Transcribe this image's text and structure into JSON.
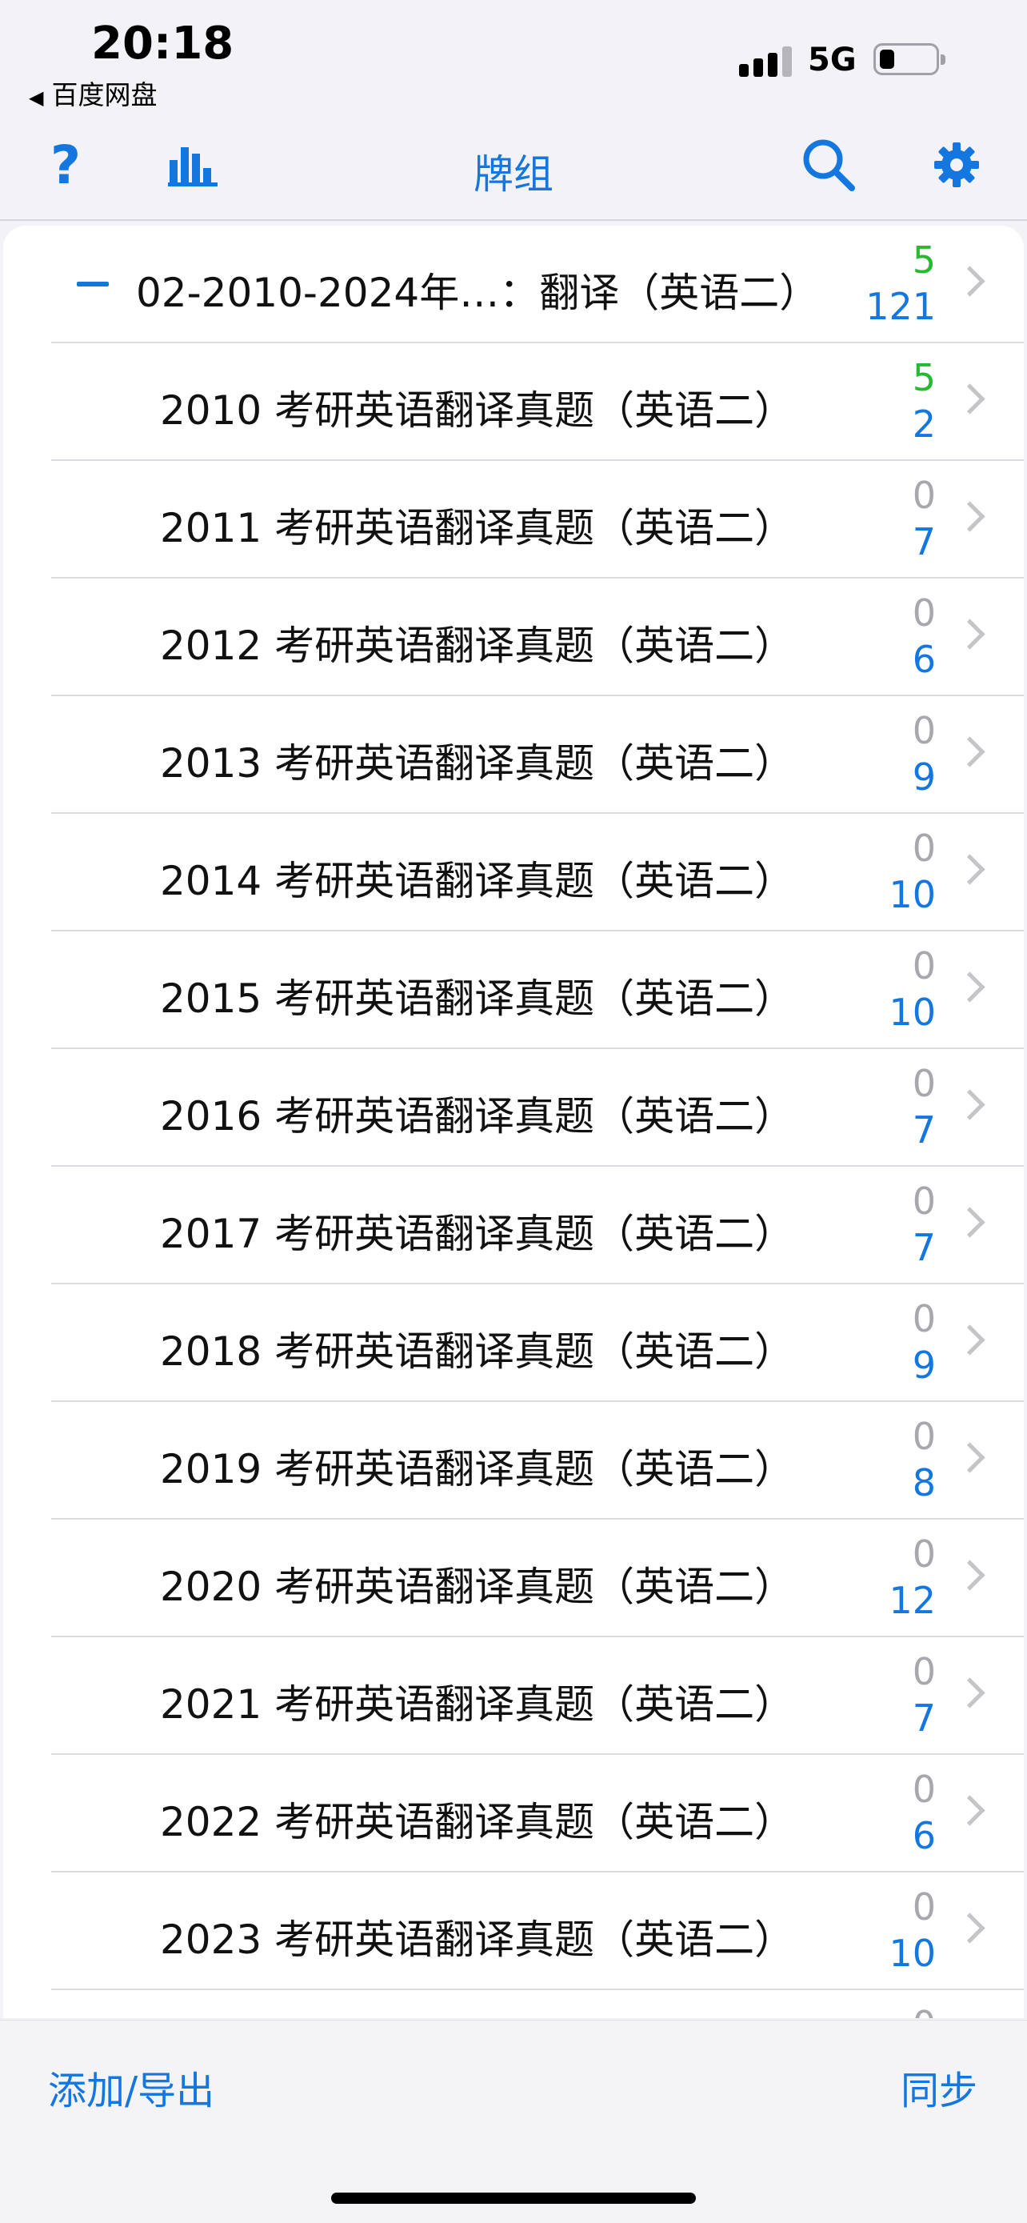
{
  "status_bar": {
    "time": "20:18",
    "back_app": "百度网盘",
    "back_arrow": "◀",
    "network": "5G",
    "signal_bars_active": 3,
    "signal_bars_total": 4,
    "battery_level": 0.25
  },
  "nav": {
    "title": "牌组",
    "help_label": "?",
    "icons": [
      "help-icon",
      "stats-icon",
      "search-icon",
      "gear-icon"
    ]
  },
  "parent_deck": {
    "title": "02-2010-2024年…：翻译（英语二）",
    "new": "5",
    "due": "121"
  },
  "decks": [
    {
      "title": "2010 考研英语翻译真题（英语二）",
      "new": "5",
      "due": "2"
    },
    {
      "title": "2011 考研英语翻译真题（英语二）",
      "new": "0",
      "due": "7"
    },
    {
      "title": "2012 考研英语翻译真题（英语二）",
      "new": "0",
      "due": "6"
    },
    {
      "title": "2013 考研英语翻译真题（英语二）",
      "new": "0",
      "due": "9"
    },
    {
      "title": "2014 考研英语翻译真题（英语二）",
      "new": "0",
      "due": "10"
    },
    {
      "title": "2015 考研英语翻译真题（英语二）",
      "new": "0",
      "due": "10"
    },
    {
      "title": "2016 考研英语翻译真题（英语二）",
      "new": "0",
      "due": "7"
    },
    {
      "title": "2017 考研英语翻译真题（英语二）",
      "new": "0",
      "due": "7"
    },
    {
      "title": "2018 考研英语翻译真题（英语二）",
      "new": "0",
      "due": "9"
    },
    {
      "title": "2019 考研英语翻译真题（英语二）",
      "new": "0",
      "due": "8"
    },
    {
      "title": "2020 考研英语翻译真题（英语二）",
      "new": "0",
      "due": "12"
    },
    {
      "title": "2021 考研英语翻译真题（英语二）",
      "new": "0",
      "due": "7"
    },
    {
      "title": "2022 考研英语翻译真题（英语二）",
      "new": "0",
      "due": "6"
    },
    {
      "title": "2023 考研英语翻译真题（英语二）",
      "new": "0",
      "due": "10"
    }
  ],
  "partial_row": {
    "new": "0"
  },
  "toolbar": {
    "add_export_label": "添加/导出",
    "sync_label": "同步"
  },
  "colors": {
    "accent": "#1477e0",
    "new_count": "#28b832",
    "zero_count": "#a7a7ad",
    "background": "#f2f2f7"
  }
}
